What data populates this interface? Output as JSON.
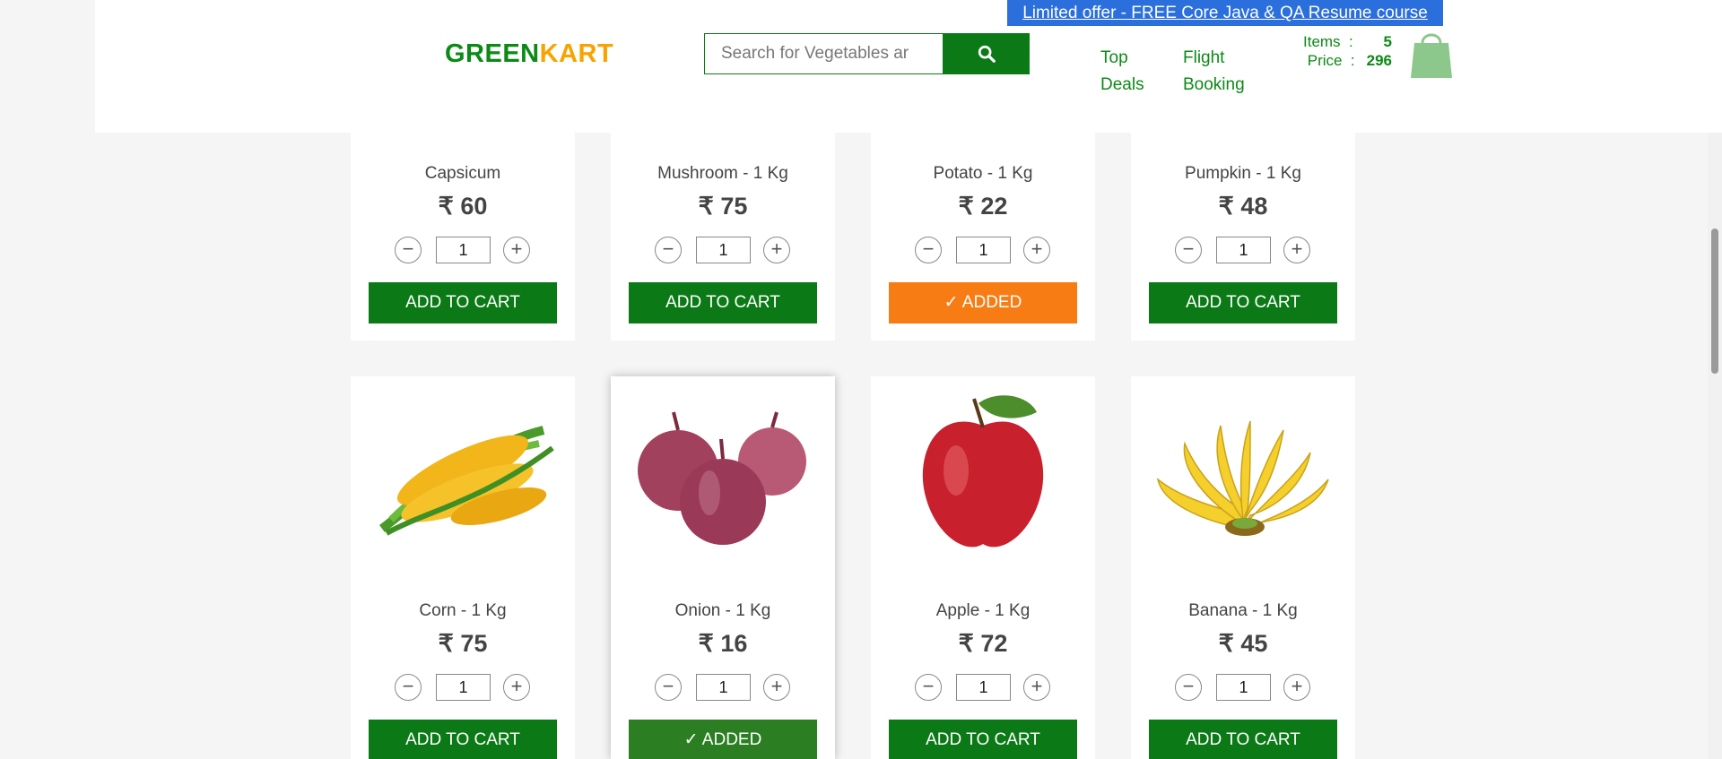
{
  "header": {
    "offer": "Limited offer - FREE Core Java & QA Resume course",
    "logo_green": "GREEN",
    "logo_kart": "KART",
    "search_placeholder": "Search for Vegetables ar",
    "nav": [
      {
        "line1": "Top",
        "line2": "Deals"
      },
      {
        "line1": "Flight",
        "line2": "Booking"
      }
    ],
    "cart": {
      "items_label": "Items",
      "price_label": "Price",
      "colon": ":",
      "items": "5",
      "price": "296"
    }
  },
  "products": [
    {
      "name": "Capsicum",
      "price": "₹ 60",
      "qty": "1",
      "button": "ADD TO CART",
      "state": "default"
    },
    {
      "name": "Mushroom - 1 Kg",
      "price": "₹ 75",
      "qty": "1",
      "button": "ADD TO CART",
      "state": "default"
    },
    {
      "name": "Potato - 1 Kg",
      "price": "₹ 22",
      "qty": "1",
      "button": "✓ ADDED",
      "state": "added"
    },
    {
      "name": "Pumpkin - 1 Kg",
      "price": "₹ 48",
      "qty": "1",
      "button": "ADD TO CART",
      "state": "default"
    },
    {
      "name": "Corn - 1 Kg",
      "price": "₹ 75",
      "qty": "1",
      "button": "ADD TO CART",
      "state": "default"
    },
    {
      "name": "Onion - 1 Kg",
      "price": "₹ 16",
      "qty": "1",
      "button": "✓ ADDED",
      "state": "added"
    },
    {
      "name": "Apple - 1 Kg",
      "price": "₹ 72",
      "qty": "1",
      "button": "ADD TO CART",
      "state": "default"
    },
    {
      "name": "Banana - 1 Kg",
      "price": "₹ 45",
      "qty": "1",
      "button": "ADD TO CART",
      "state": "default"
    }
  ],
  "stepper": {
    "minus": "−",
    "plus": "+"
  },
  "colors": {
    "brand_green": "#0b7a16",
    "added_orange": "#f77c14",
    "logo_orange": "#f7a400",
    "offer_blue": "#2a6fdb"
  }
}
